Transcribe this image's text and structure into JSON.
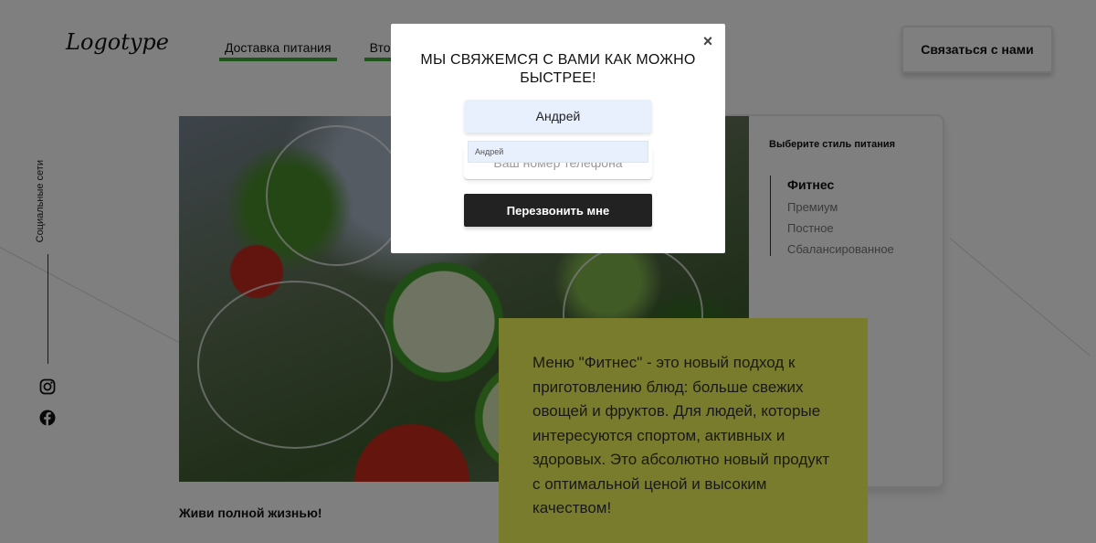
{
  "header": {
    "logo": "Logotype",
    "nav": [
      "Доставка питания",
      "Второ"
    ],
    "contact_button": "Связаться с нами"
  },
  "social": {
    "label": "Социальные сети",
    "icons": [
      "instagram-icon",
      "facebook-icon"
    ]
  },
  "style_selector": {
    "title": "Выберите стиль питания",
    "options": [
      "Фитнес",
      "Премиум",
      "Постное",
      "Сбалансированное"
    ],
    "selected": "Фитнес"
  },
  "description": "Меню \"Фитнес\" - это новый подход к приготовлению блюд: больше свежих овощей и фруктов. Для людей, которые интересуются спортом, активных и здоровых. Это абсолютно новый продукт с оптимальной ценой и высоким качеством!",
  "tagline": "Живи полной жизнью!",
  "modal": {
    "close": "×",
    "title": "МЫ СВЯЖЕМСЯ С ВАМИ КАК МОЖНО БЫСТРЕЕ!",
    "name_value": "Андрей",
    "autofill_suggestion": "Андрей",
    "phone_placeholder": "Ваш номер телефона",
    "submit_label": "Перезвонить мне"
  },
  "colors": {
    "nav_underline": "#3aa935",
    "description_bg": "#f4f85a",
    "submit_bg": "#222222",
    "autofill_bg": "#e8effd"
  }
}
